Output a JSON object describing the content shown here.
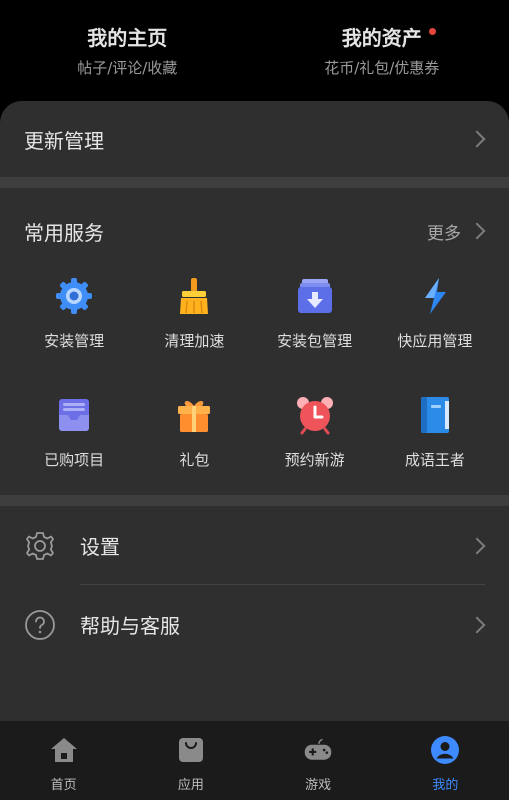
{
  "header": {
    "home": {
      "title": "我的主页",
      "subtitle": "帖子/评论/收藏"
    },
    "assets": {
      "title": "我的资产",
      "subtitle": "花币/礼包/优惠券"
    }
  },
  "update_row": {
    "label": "更新管理"
  },
  "services": {
    "title": "常用服务",
    "more_label": "更多",
    "items": [
      {
        "label": "安装管理",
        "icon": "gear-icon"
      },
      {
        "label": "清理加速",
        "icon": "broom-icon"
      },
      {
        "label": "安装包管理",
        "icon": "package-download-icon"
      },
      {
        "label": "快应用管理",
        "icon": "lightning-icon"
      },
      {
        "label": "已购项目",
        "icon": "purchased-tray-icon"
      },
      {
        "label": "礼包",
        "icon": "gift-icon"
      },
      {
        "label": "预约新游",
        "icon": "alarm-clock-icon"
      },
      {
        "label": "成语王者",
        "icon": "book-icon"
      }
    ]
  },
  "settings": {
    "label": "设置"
  },
  "help": {
    "label": "帮助与客服"
  },
  "nav": {
    "items": [
      {
        "label": "首页",
        "icon": "home-icon",
        "active": false
      },
      {
        "label": "应用",
        "icon": "shopping-bag-icon",
        "active": false
      },
      {
        "label": "游戏",
        "icon": "gamepad-icon",
        "active": false
      },
      {
        "label": "我的",
        "icon": "user-icon",
        "active": true
      }
    ]
  },
  "colors": {
    "accent": "#3d8bff",
    "badge_red": "#e8453c",
    "background": "#000000",
    "card": "#2f2f2f"
  }
}
